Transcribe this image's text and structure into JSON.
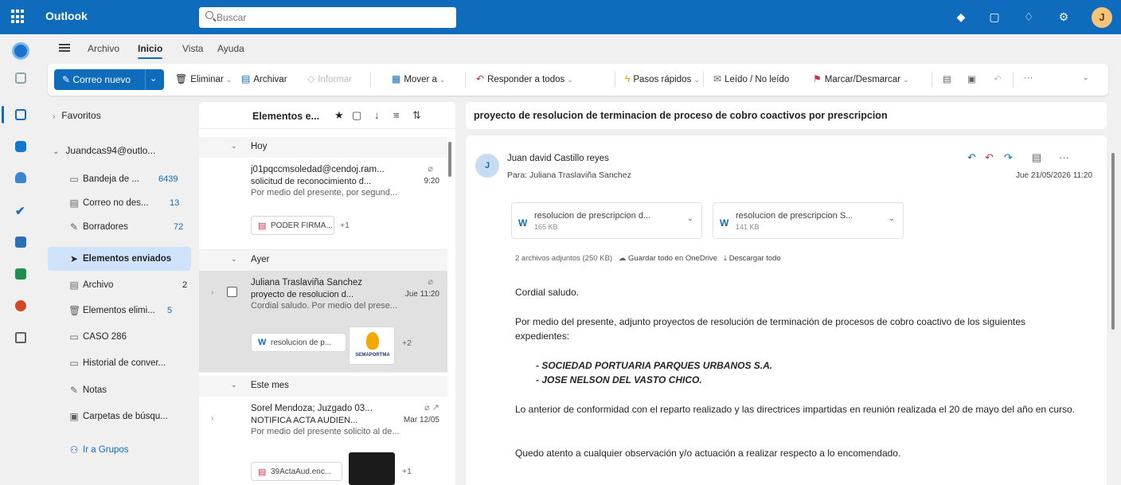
{
  "topbar": {
    "app_name": "Outlook",
    "search_placeholder": "Buscar",
    "avatar_letter": "J"
  },
  "ribbon": {
    "tabs": [
      "Archivo",
      "Inicio",
      "Vista",
      "Ayuda"
    ],
    "active_tab": "Inicio",
    "new_mail": "Correo nuevo",
    "delete": "Eliminar",
    "archive": "Archivar",
    "report": "Informar",
    "move_to": "Mover a",
    "reply_all": "Responder a todos",
    "quick_steps": "Pasos rápidos",
    "read_unread": "Leído / No leído",
    "flag": "Marcar/Desmarcar",
    "more": "···"
  },
  "folders": {
    "favorites": "Favoritos",
    "account": "Juandcas94@outlo...",
    "items": [
      {
        "label": "Bandeja de ...",
        "count": "6439",
        "icon": "inbox-icon"
      },
      {
        "label": "Correo no des...",
        "count": "13",
        "icon": "junk-icon"
      },
      {
        "label": "Borradores",
        "count": "72",
        "icon": "drafts-icon"
      },
      {
        "label": "Elementos enviados",
        "count": "",
        "icon": "sent-icon"
      },
      {
        "label": "Archivo",
        "count": "2",
        "icon": "archive-icon"
      },
      {
        "label": "Elementos elimi...",
        "count": "5",
        "icon": "trash-icon"
      },
      {
        "label": "CASO 286",
        "count": "",
        "icon": "folder-icon"
      },
      {
        "label": "Historial de conver...",
        "count": "",
        "icon": "folder-icon"
      },
      {
        "label": "Notas",
        "count": "",
        "icon": "notes-icon"
      },
      {
        "label": "Carpetas de búsqu...",
        "count": "",
        "icon": "search-folder-icon"
      }
    ],
    "groups_link": "Ir a Grupos"
  },
  "message_list": {
    "title": "Elementos e...",
    "groups": [
      {
        "label": "Hoy",
        "messages": [
          {
            "sender": "j01pqccmsoledad@cendoj.ram...",
            "subject": "solicitud de reconocimiento d...",
            "date": "9:20",
            "preview": "Por medio del presente, por segund...",
            "attachment": "PODER FIRMA...",
            "more_attachments": "+1"
          }
        ]
      },
      {
        "label": "Ayer",
        "messages": [
          {
            "sender": "Juliana Traslaviña Sanchez",
            "subject": "proyecto de resolucion d...",
            "date": "Jue 11:20",
            "preview": "Cordial saludo. Por medio del prese...",
            "attachment": "resolucion de p...",
            "thumb_label": "SEMAPORTMA",
            "more_attachments": "+2"
          }
        ]
      },
      {
        "label": "Este mes",
        "messages": [
          {
            "sender": "Sorel Mendoza; Juzgado 03...",
            "subject": "NOTIFICA ACTA AUDIEN...",
            "date": "Mar 12/05",
            "preview": "Por medio del presente solicito al de...",
            "attachment": "39ActaAud.enc...",
            "more_attachments": "+1"
          }
        ]
      }
    ]
  },
  "reading": {
    "subject": "proyecto de resolucion de terminacion de proceso de cobro coactivos por prescripcion",
    "avatar_letter": "J",
    "from": "Juan david Castillo reyes",
    "to": "Para: Juliana Traslaviña Sanchez",
    "date": "Jue 21/05/2026 11:20",
    "attachments": [
      {
        "name": "resolucion de prescripcion d...",
        "size": "165 KB"
      },
      {
        "name": "resolucion de prescripcion S...",
        "size": "141 KB"
      }
    ],
    "attachments_info": "2 archivos adjuntos (250 KB)",
    "save_onedrive": "Guardar todo en OneDrive",
    "download_all": "Descargar todo",
    "body": {
      "greeting": "Cordial saludo.",
      "p1": "Por medio del presente, adjunto proyectos de resolución de terminación de procesos de cobro coactivo de los siguientes expedientes:",
      "item1": "- SOCIEDAD PORTUARIA PARQUES URBANOS S.A.",
      "item2": "- JOSE NELSON DEL VASTO CHICO.",
      "p2": "Lo anterior de conformidad con el reparto realizado y las directrices impartidas en reunión realizada el 20 de mayo del año en curso.",
      "p3": "Quedo atento a cualquier observación y/o actuación a realizar respecto a lo encomendado."
    }
  },
  "colors": {
    "brand": "#0f6cbd",
    "selected_folder": "#cfe4fa",
    "selected_message": "#e1e1e1"
  }
}
